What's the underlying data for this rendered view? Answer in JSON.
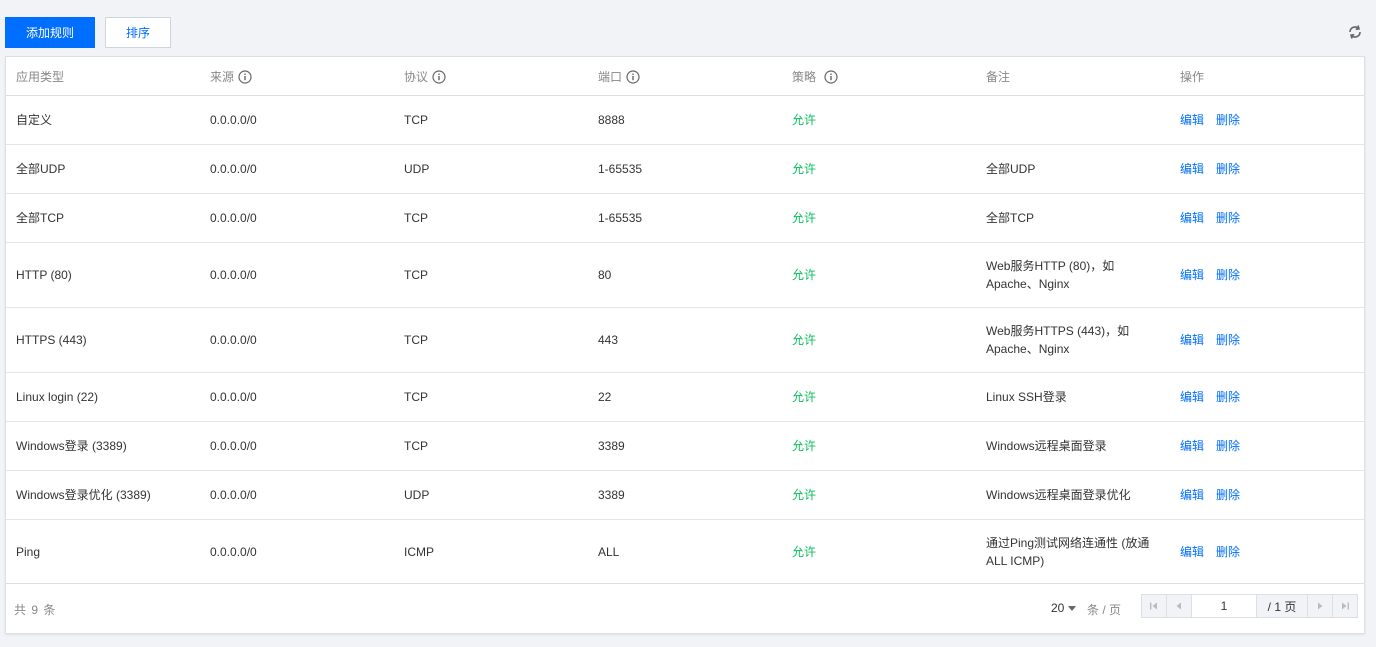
{
  "toolbar": {
    "add_label": "添加规则",
    "sort_label": "排序"
  },
  "table": {
    "headers": [
      "应用类型",
      "来源",
      "协议",
      "端口",
      "策略",
      "备注",
      "操作"
    ],
    "rows": [
      {
        "type": "自定义",
        "source": "0.0.0.0/0",
        "protocol": "TCP",
        "port": "8888",
        "policy": "允许",
        "note": ""
      },
      {
        "type": "全部UDP",
        "source": "0.0.0.0/0",
        "protocol": "UDP",
        "port": "1-65535",
        "policy": "允许",
        "note": "全部UDP"
      },
      {
        "type": "全部TCP",
        "source": "0.0.0.0/0",
        "protocol": "TCP",
        "port": "1-65535",
        "policy": "允许",
        "note": "全部TCP"
      },
      {
        "type": "HTTP (80)",
        "source": "0.0.0.0/0",
        "protocol": "TCP",
        "port": "80",
        "policy": "允许",
        "note": "Web服务HTTP (80)，如 Apache、Nginx"
      },
      {
        "type": "HTTPS (443)",
        "source": "0.0.0.0/0",
        "protocol": "TCP",
        "port": "443",
        "policy": "允许",
        "note": "Web服务HTTPS (443)，如 Apache、Nginx"
      },
      {
        "type": "Linux login (22)",
        "source": "0.0.0.0/0",
        "protocol": "TCP",
        "port": "22",
        "policy": "允许",
        "note": "Linux SSH登录"
      },
      {
        "type": "Windows登录 (3389)",
        "source": "0.0.0.0/0",
        "protocol": "TCP",
        "port": "3389",
        "policy": "允许",
        "note": "Windows远程桌面登录"
      },
      {
        "type": "Windows登录优化 (3389)",
        "source": "0.0.0.0/0",
        "protocol": "UDP",
        "port": "3389",
        "policy": "允许",
        "note": "Windows远程桌面登录优化"
      },
      {
        "type": "Ping",
        "source": "0.0.0.0/0",
        "protocol": "ICMP",
        "port": "ALL",
        "policy": "允许",
        "note": "通过Ping测试网络连通性 (放通 ALL ICMP)"
      }
    ],
    "actions": {
      "edit": "编辑",
      "delete": "删除"
    }
  },
  "footer": {
    "total_text": "共 9 条",
    "page_size": "20",
    "per_page_text": "条 / 页",
    "current_page": "1",
    "total_pages_text": "/ 1 页"
  },
  "colors": {
    "primary": "#006eff",
    "allow": "#0abf5b"
  }
}
